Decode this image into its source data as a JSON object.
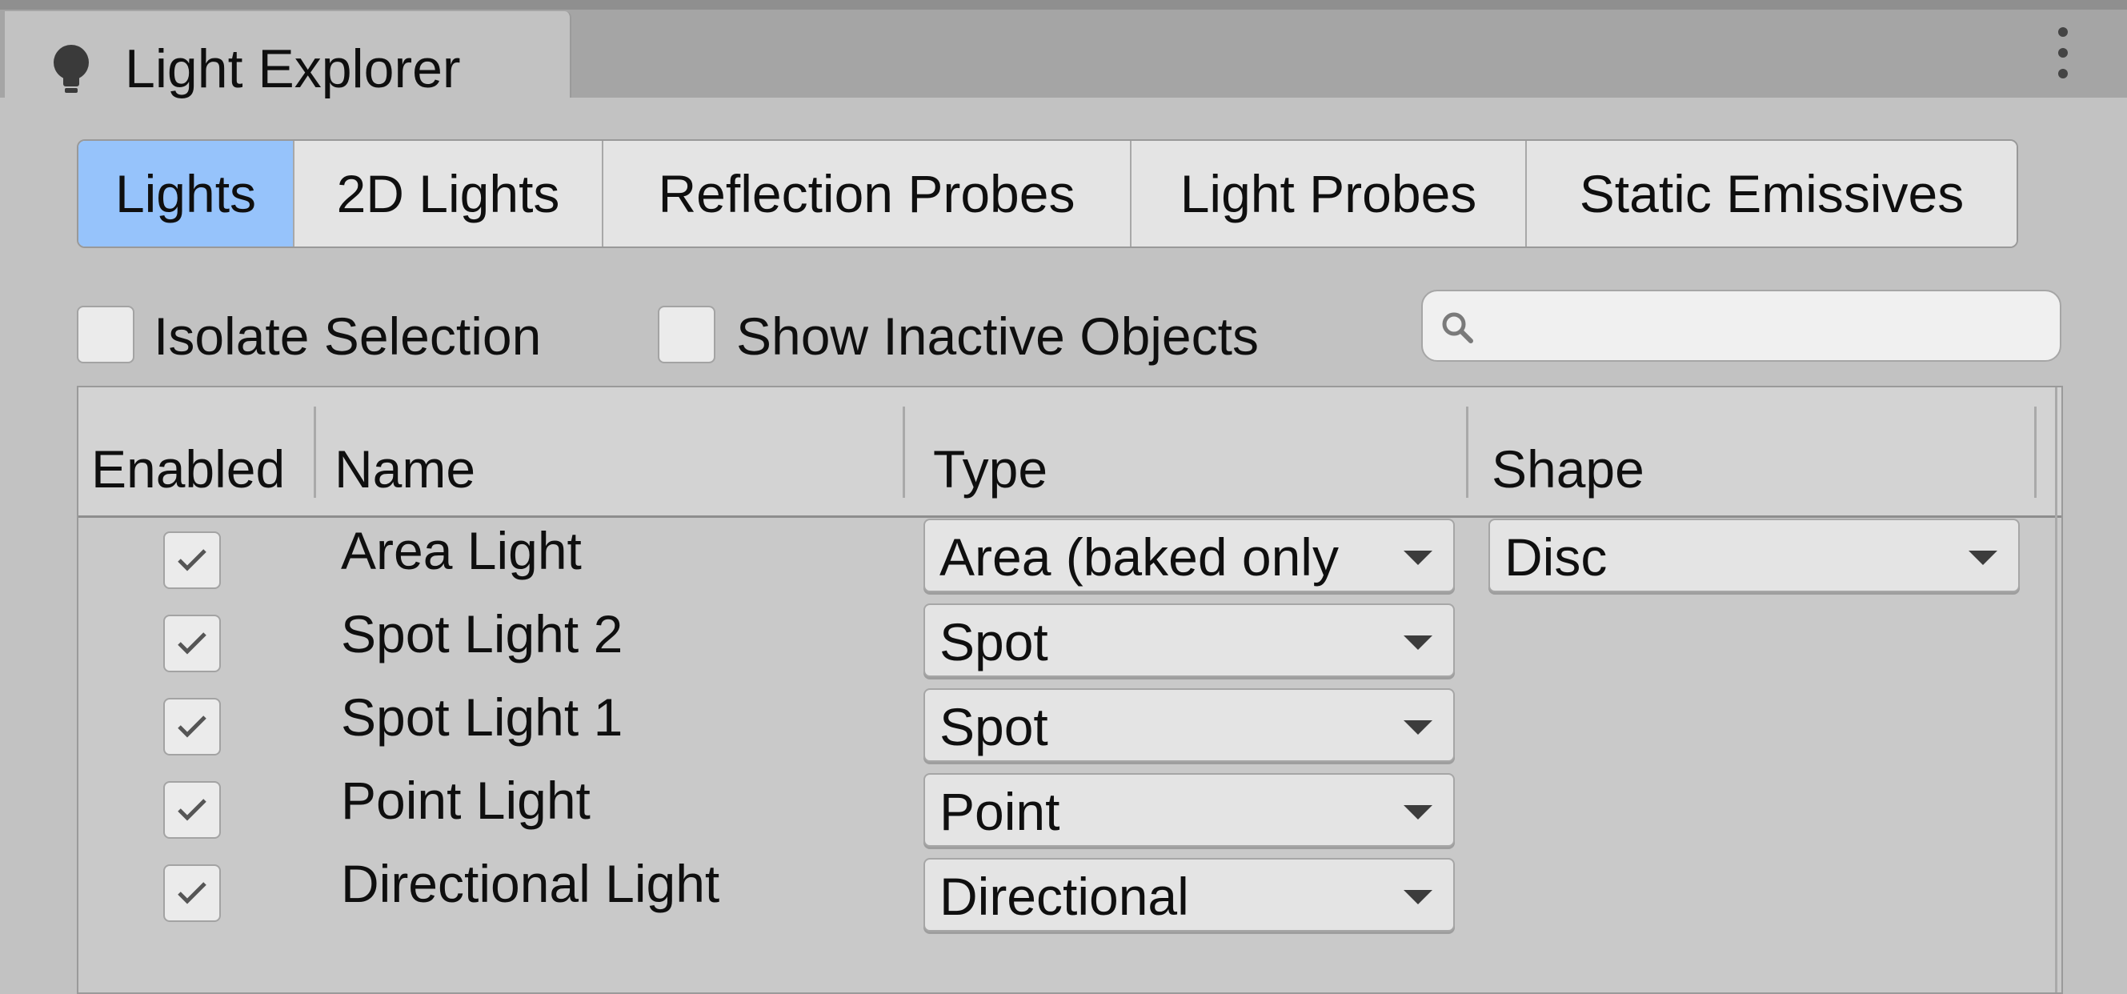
{
  "window": {
    "tab_title": "Light Explorer",
    "tab_icon": "lightbulb-icon",
    "menu_icon": "kebab-menu-icon"
  },
  "tabs": [
    {
      "label": "Lights",
      "active": true
    },
    {
      "label": "2D Lights",
      "active": false
    },
    {
      "label": "Reflection Probes",
      "active": false
    },
    {
      "label": "Light Probes",
      "active": false
    },
    {
      "label": "Static Emissives",
      "active": false
    }
  ],
  "toggles": {
    "isolate_selection": {
      "label": "Isolate Selection",
      "checked": false
    },
    "show_inactive": {
      "label": "Show Inactive Objects",
      "checked": false
    }
  },
  "search": {
    "value": "",
    "placeholder": ""
  },
  "table": {
    "headers": {
      "enabled": "Enabled",
      "name": "Name",
      "type": "Type",
      "shape": "Shape"
    },
    "rows": [
      {
        "enabled": true,
        "name": "Area Light",
        "type": "Area (baked only",
        "shape": "Disc"
      },
      {
        "enabled": true,
        "name": "Spot Light 2",
        "type": "Spot",
        "shape": ""
      },
      {
        "enabled": true,
        "name": "Spot Light 1",
        "type": "Spot",
        "shape": ""
      },
      {
        "enabled": true,
        "name": "Point Light",
        "type": "Point",
        "shape": ""
      },
      {
        "enabled": true,
        "name": "Directional Light",
        "type": "Directional",
        "shape": ""
      }
    ]
  },
  "colors": {
    "active_tab": "#96c3fb",
    "panel_bg": "#c2c2c2",
    "titlebar_bg": "#a5a5a5"
  }
}
